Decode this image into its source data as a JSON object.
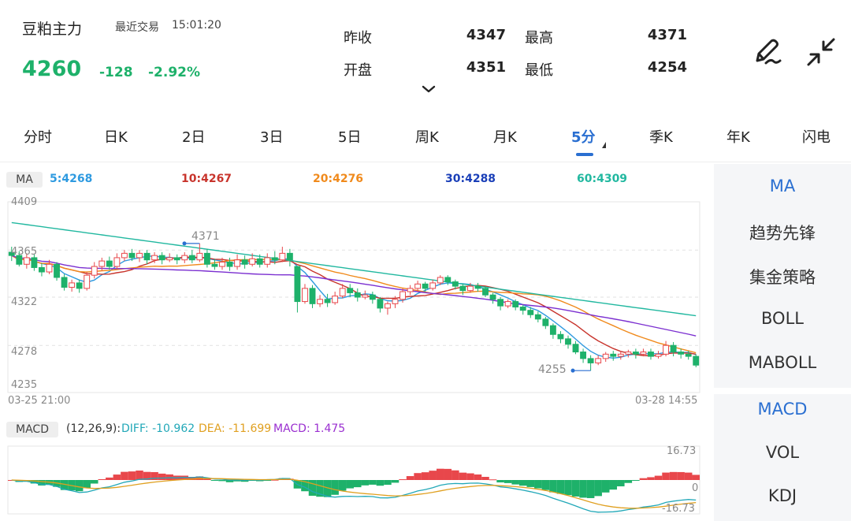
{
  "header": {
    "instrument": "豆粕主力",
    "trade_label": "最近交易",
    "trade_time": "15:01:20",
    "price": "4260",
    "change": "-128",
    "change_pct": "-2.92%",
    "stats": {
      "prev_close_label": "昨收",
      "prev_close": "4347",
      "high_label": "最高",
      "high": "4371",
      "open_label": "开盘",
      "open": "4351",
      "low_label": "最低",
      "low": "4254"
    }
  },
  "tabs": [
    "分时",
    "日K",
    "2日",
    "3日",
    "5日",
    "周K",
    "月K",
    "5分",
    "季K",
    "年K",
    "闪电"
  ],
  "active_tab": "5分",
  "ma_bar": {
    "badge": "MA",
    "ma5": "5:4268",
    "ma10": "10:4267",
    "ma20": "20:4276",
    "ma30": "30:4288",
    "ma60": "60:4309"
  },
  "macd_bar": {
    "badge": "MACD",
    "params": "(12,26,9):",
    "diff": "DIFF: -10.962",
    "dea": "DEA: -11.699",
    "macd": "MACD: 1.475"
  },
  "sidebar": {
    "main_indicators": [
      "MA",
      "趋势先锋",
      "集金策略",
      "BOLL",
      "MABOLL"
    ],
    "sub_indicators": [
      "MACD",
      "VOL",
      "KDJ"
    ],
    "active_main": "MA",
    "active_sub": "MACD"
  },
  "colors": {
    "up": "#e8474b",
    "down": "#1eb16a",
    "ma5": "#2e9ae0",
    "ma10": "#c8342c",
    "ma20": "#f08a1c",
    "ma30": "#7b2fd0",
    "ma60": "#22b8a0",
    "accent": "#2a6fd1"
  },
  "chart_data": [
    {
      "type": "candlestick",
      "y_ticks": [
        "4409",
        "4365",
        "4322",
        "4278",
        "4235"
      ],
      "ylim": [
        4235,
        4409
      ],
      "x_start_label": "03-25 21:00",
      "x_end_label": "03-28 14:55",
      "high_marker": "4371",
      "low_marker": "4255",
      "candles": [
        [
          4363,
          4360,
          4368,
          4355
        ],
        [
          4360,
          4352,
          4364,
          4350
        ],
        [
          4352,
          4358,
          4362,
          4348
        ],
        [
          4358,
          4349,
          4361,
          4346
        ],
        [
          4349,
          4345,
          4353,
          4341
        ],
        [
          4345,
          4352,
          4356,
          4343
        ],
        [
          4352,
          4340,
          4354,
          4337
        ],
        [
          4340,
          4331,
          4343,
          4328
        ],
        [
          4331,
          4335,
          4338,
          4327
        ],
        [
          4335,
          4330,
          4338,
          4326
        ],
        [
          4330,
          4342,
          4345,
          4328
        ],
        [
          4342,
          4350,
          4354,
          4339
        ],
        [
          4350,
          4355,
          4358,
          4346
        ],
        [
          4355,
          4350,
          4359,
          4347
        ],
        [
          4350,
          4358,
          4362,
          4348
        ],
        [
          4358,
          4362,
          4365,
          4355
        ],
        [
          4362,
          4358,
          4366,
          4355
        ],
        [
          4358,
          4362,
          4365,
          4354
        ],
        [
          4362,
          4356,
          4365,
          4352
        ],
        [
          4356,
          4360,
          4363,
          4353
        ],
        [
          4360,
          4356,
          4363,
          4352
        ],
        [
          4356,
          4358,
          4362,
          4354
        ],
        [
          4358,
          4356,
          4361,
          4352
        ],
        [
          4356,
          4360,
          4363,
          4353
        ],
        [
          4360,
          4356,
          4365,
          4353
        ],
        [
          4356,
          4362,
          4371,
          4354
        ],
        [
          4362,
          4352,
          4366,
          4349
        ],
        [
          4352,
          4350,
          4357,
          4347
        ],
        [
          4350,
          4354,
          4358,
          4347
        ],
        [
          4354,
          4350,
          4358,
          4346
        ],
        [
          4350,
          4356,
          4361,
          4347
        ],
        [
          4356,
          4352,
          4360,
          4348
        ],
        [
          4352,
          4357,
          4362,
          4350
        ],
        [
          4357,
          4352,
          4361,
          4349
        ],
        [
          4352,
          4358,
          4362,
          4349
        ],
        [
          4358,
          4356,
          4364,
          4352
        ],
        [
          4356,
          4362,
          4368,
          4354
        ],
        [
          4362,
          4356,
          4366,
          4350
        ],
        [
          4350,
          4318,
          4350,
          4308
        ],
        [
          4318,
          4330,
          4334,
          4316
        ],
        [
          4330,
          4316,
          4333,
          4312
        ],
        [
          4316,
          4320,
          4324,
          4313
        ],
        [
          4320,
          4317,
          4325,
          4313
        ],
        [
          4317,
          4323,
          4327,
          4315
        ],
        [
          4323,
          4330,
          4334,
          4321
        ],
        [
          4330,
          4326,
          4334,
          4322
        ],
        [
          4326,
          4322,
          4330,
          4318
        ],
        [
          4322,
          4324,
          4328,
          4320
        ],
        [
          4324,
          4320,
          4327,
          4316
        ],
        [
          4320,
          4312,
          4322,
          4308
        ],
        [
          4312,
          4316,
          4318,
          4306
        ],
        [
          4316,
          4320,
          4323,
          4312
        ],
        [
          4320,
          4327,
          4330,
          4317
        ],
        [
          4327,
          4330,
          4333,
          4324
        ],
        [
          4330,
          4334,
          4337,
          4327
        ],
        [
          4334,
          4330,
          4336,
          4327
        ],
        [
          4330,
          4335,
          4338,
          4328
        ],
        [
          4335,
          4340,
          4342,
          4333
        ],
        [
          4340,
          4336,
          4342,
          4333
        ],
        [
          4336,
          4332,
          4338,
          4329
        ],
        [
          4332,
          4328,
          4334,
          4324
        ],
        [
          4328,
          4332,
          4335,
          4326
        ],
        [
          4332,
          4330,
          4335,
          4327
        ],
        [
          4330,
          4324,
          4332,
          4322
        ],
        [
          4324,
          4320,
          4326,
          4316
        ],
        [
          4320,
          4314,
          4322,
          4310
        ],
        [
          4314,
          4318,
          4320,
          4312
        ],
        [
          4318,
          4313,
          4320,
          4310
        ],
        [
          4313,
          4310,
          4315,
          4306
        ],
        [
          4310,
          4306,
          4313,
          4303
        ],
        [
          4306,
          4302,
          4309,
          4299
        ],
        [
          4302,
          4296,
          4304,
          4293
        ],
        [
          4296,
          4288,
          4298,
          4284
        ],
        [
          4288,
          4284,
          4291,
          4280
        ],
        [
          4284,
          4279,
          4287,
          4275
        ],
        [
          4279,
          4272,
          4282,
          4270
        ],
        [
          4272,
          4266,
          4275,
          4262
        ],
        [
          4266,
          4262,
          4269,
          4255
        ],
        [
          4262,
          4266,
          4269,
          4260
        ],
        [
          4266,
          4270,
          4272,
          4263
        ],
        [
          4270,
          4268,
          4273,
          4264
        ],
        [
          4268,
          4270,
          4273,
          4265
        ],
        [
          4270,
          4272,
          4274,
          4267
        ],
        [
          4272,
          4270,
          4275,
          4266
        ],
        [
          4270,
          4272,
          4275,
          4268
        ],
        [
          4272,
          4268,
          4275,
          4265
        ],
        [
          4268,
          4270,
          4273,
          4266
        ],
        [
          4270,
          4278,
          4282,
          4268
        ],
        [
          4278,
          4272,
          4281,
          4268
        ],
        [
          4272,
          4270,
          4275,
          4266
        ],
        [
          4270,
          4268,
          4273,
          4265
        ],
        [
          4268,
          4260,
          4270,
          4258
        ]
      ]
    },
    {
      "type": "macd",
      "y_ticks": [
        "16.73",
        "0",
        "-16.73"
      ],
      "ylim": [
        -16.73,
        16.73
      ]
    }
  ]
}
